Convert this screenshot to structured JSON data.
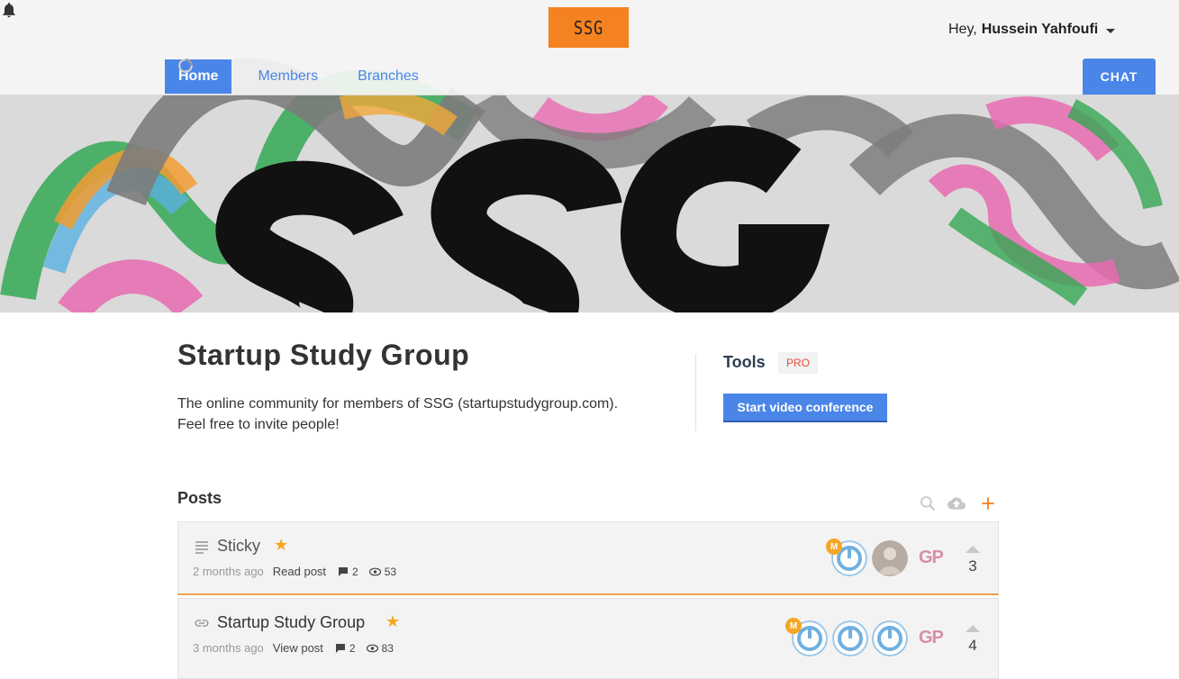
{
  "brand": {
    "logo_text": "SSG",
    "logo_color": "#f58220"
  },
  "header": {
    "greeting": "Hey,",
    "user_name": "Hussein Yahfoufi",
    "nav": [
      {
        "label": "Home",
        "active": true
      },
      {
        "label": "Members",
        "active": false
      },
      {
        "label": "Branches",
        "active": false
      }
    ],
    "chat_label": "CHAT",
    "accent_color": "#4a86e8"
  },
  "group": {
    "title": "Startup Study Group",
    "description_line1": "The online community for members of SSG (startupstudygroup.com).",
    "description_line2": "Feel free to invite people!"
  },
  "tools": {
    "label": "Tools",
    "badge": "PRO",
    "video_button": "Start video conference"
  },
  "posts": {
    "heading": "Posts",
    "toolbar_icons": [
      "search-icon",
      "cloud-upload-icon",
      "plus-icon"
    ],
    "items": [
      {
        "type_icon": "text-lines-icon",
        "title": "Sticky",
        "starred": true,
        "age": "2 months ago",
        "action": "Read post",
        "comments": "2",
        "views": "53",
        "participant_badge": "M",
        "participant_initials": "GP",
        "votes": "3"
      },
      {
        "type_icon": "link-icon",
        "title": "Startup Study Group",
        "starred": true,
        "age": "3 months ago",
        "action": "View post",
        "comments": "2",
        "views": "83",
        "participant_badge": "M",
        "participant_initials": "GP",
        "votes": "4"
      }
    ]
  }
}
